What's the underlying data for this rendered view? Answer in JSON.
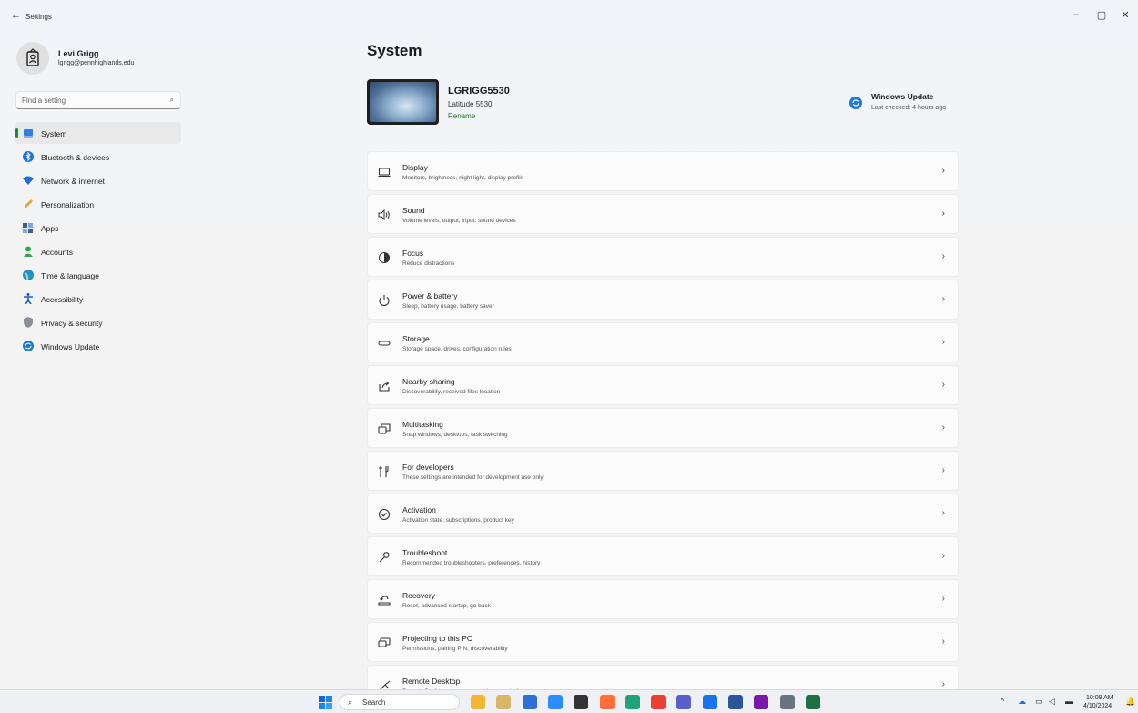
{
  "titlebar": {
    "app_title": "Settings",
    "back_glyph": "←",
    "minimize_glyph": "–",
    "restore_glyph": "▢",
    "close_glyph": "✕"
  },
  "profile": {
    "name": "Levi Grigg",
    "email": "lgrigg@pennhighlands.edu"
  },
  "search": {
    "placeholder": "Find a setting"
  },
  "nav": {
    "items": [
      {
        "label": "System",
        "icon": "system-icon",
        "color": "#2f7ed8",
        "active": true
      },
      {
        "label": "Bluetooth & devices",
        "icon": "bluetooth-icon",
        "color": "#1a73e8"
      },
      {
        "label": "Network & internet",
        "icon": "wifi-icon",
        "color": "#1f6fd1"
      },
      {
        "label": "Personalization",
        "icon": "brush-icon",
        "color": "#e8a23a"
      },
      {
        "label": "Apps",
        "icon": "apps-icon",
        "color": "#4a5c7a"
      },
      {
        "label": "Accounts",
        "icon": "accounts-icon",
        "color": "#2fa84f"
      },
      {
        "label": "Time & language",
        "icon": "globe-icon",
        "color": "#1f8fd1"
      },
      {
        "label": "Accessibility",
        "icon": "accessibility-icon",
        "color": "#1a5fb4"
      },
      {
        "label": "Privacy & security",
        "icon": "shield-icon",
        "color": "#8a8f98"
      },
      {
        "label": "Windows Update",
        "icon": "update-icon",
        "color": "#1f7ad6"
      }
    ]
  },
  "main": {
    "title": "System",
    "device": {
      "name": "LGRIGG5530",
      "model": "Latitude 5530",
      "rename": "Rename"
    },
    "windows_update": {
      "title": "Windows Update",
      "subtitle": "Last checked: 4 hours ago"
    },
    "cards": [
      {
        "title": "Display",
        "subtitle": "Monitors, brightness, night light, display profile",
        "icon": "display-icon"
      },
      {
        "title": "Sound",
        "subtitle": "Volume levels, output, input, sound devices",
        "icon": "speaker-icon"
      },
      {
        "title": "Focus",
        "subtitle": "Reduce distractions",
        "icon": "focus-icon"
      },
      {
        "title": "Power & battery",
        "subtitle": "Sleep, battery usage, battery saver",
        "icon": "power-icon"
      },
      {
        "title": "Storage",
        "subtitle": "Storage space, drives, configuration rules",
        "icon": "storage-icon"
      },
      {
        "title": "Nearby sharing",
        "subtitle": "Discoverability, received files location",
        "icon": "share-icon"
      },
      {
        "title": "Multitasking",
        "subtitle": "Snap windows, desktops, task switching",
        "icon": "multitasking-icon"
      },
      {
        "title": "For developers",
        "subtitle": "These settings are intended for development use only",
        "icon": "developer-tools-icon"
      },
      {
        "title": "Activation",
        "subtitle": "Activation state, subscriptions, product key",
        "icon": "checkmark-circle-icon"
      },
      {
        "title": "Troubleshoot",
        "subtitle": "Recommended troubleshooters, preferences, history",
        "icon": "wrench-icon"
      },
      {
        "title": "Recovery",
        "subtitle": "Reset, advanced startup, go back",
        "icon": "recovery-icon"
      },
      {
        "title": "Projecting to this PC",
        "subtitle": "Permissions, pairing PIN, discoverability",
        "icon": "projecting-icon"
      },
      {
        "title": "Remote Desktop",
        "subtitle": "Remote Desktop users, connection permissions",
        "icon": "remote-desktop-icon"
      }
    ],
    "chevron_glyph": "›"
  },
  "taskbar": {
    "search_label": "Search",
    "apps": [
      {
        "name": "file-explorer-icon",
        "color": "#f2b632"
      },
      {
        "name": "pen-app-icon",
        "color": "#d7b66a"
      },
      {
        "name": "r-app-icon",
        "color": "#2f6fd6"
      },
      {
        "name": "zoom-icon",
        "color": "#2d8cff"
      },
      {
        "name": "chatgpt-icon",
        "color": "#333333"
      },
      {
        "name": "firefox-icon",
        "color": "#ff7139"
      },
      {
        "name": "edge-icon",
        "color": "#1fa37a"
      },
      {
        "name": "chrome-icon",
        "color": "#e94235"
      },
      {
        "name": "teams-icon",
        "color": "#5b5fc7"
      },
      {
        "name": "outlook-icon",
        "color": "#1a73e8"
      },
      {
        "name": "word-icon",
        "color": "#2b579a"
      },
      {
        "name": "onenote-icon",
        "color": "#7719aa"
      },
      {
        "name": "settings-gear-icon",
        "color": "#6b7380"
      },
      {
        "name": "excel-icon",
        "color": "#1d7044"
      }
    ],
    "tray": {
      "chevron_up": "^",
      "time": "10:09 AM",
      "date": "4/10/2024"
    }
  }
}
